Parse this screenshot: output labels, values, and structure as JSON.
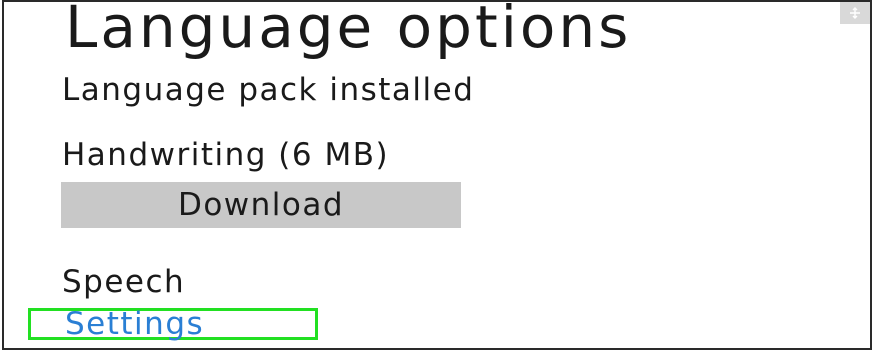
{
  "title": "Language options",
  "status": "Language pack installed",
  "handwriting": {
    "label": "Handwriting (6 MB)",
    "download_label": "Download"
  },
  "speech": {
    "label": "Speech",
    "settings_link": "Settings"
  },
  "corner_icon": "expand-icon",
  "colors": {
    "link": "#2a7fd4",
    "highlight": "#22e022",
    "button": "#c8c8c8"
  }
}
